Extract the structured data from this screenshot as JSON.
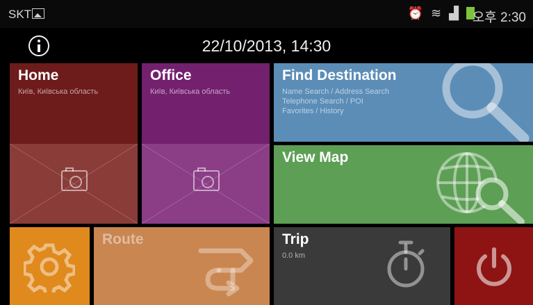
{
  "status_bar": {
    "carrier": "SKT",
    "time": "오후 2:30",
    "icons": [
      "gallery-icon",
      "alarm-icon",
      "wifi-icon",
      "signal-icon",
      "battery-icon"
    ]
  },
  "header": {
    "datetime": "22/10/2013, 14:30"
  },
  "tiles": {
    "home": {
      "title": "Home",
      "subtitle": "Київ, Київська область",
      "color": "#6e1b1b"
    },
    "office": {
      "title": "Office",
      "subtitle": "Київ, Київська область",
      "color": "#73206e"
    },
    "find": {
      "title": "Find Destination",
      "lines": [
        "Name Search / Address Search",
        "Telephone Search / POI",
        "Favorites / History"
      ],
      "color": "#5b8db7"
    },
    "map": {
      "title": "View Map",
      "color": "#5d9f55"
    },
    "settings": {
      "color": "#e0891d"
    },
    "route": {
      "title": "Route",
      "color": "#c98650"
    },
    "trip": {
      "title": "Trip",
      "distance": "0.0 km",
      "color": "#3a3a3a"
    },
    "power": {
      "color": "#8e1414"
    }
  }
}
